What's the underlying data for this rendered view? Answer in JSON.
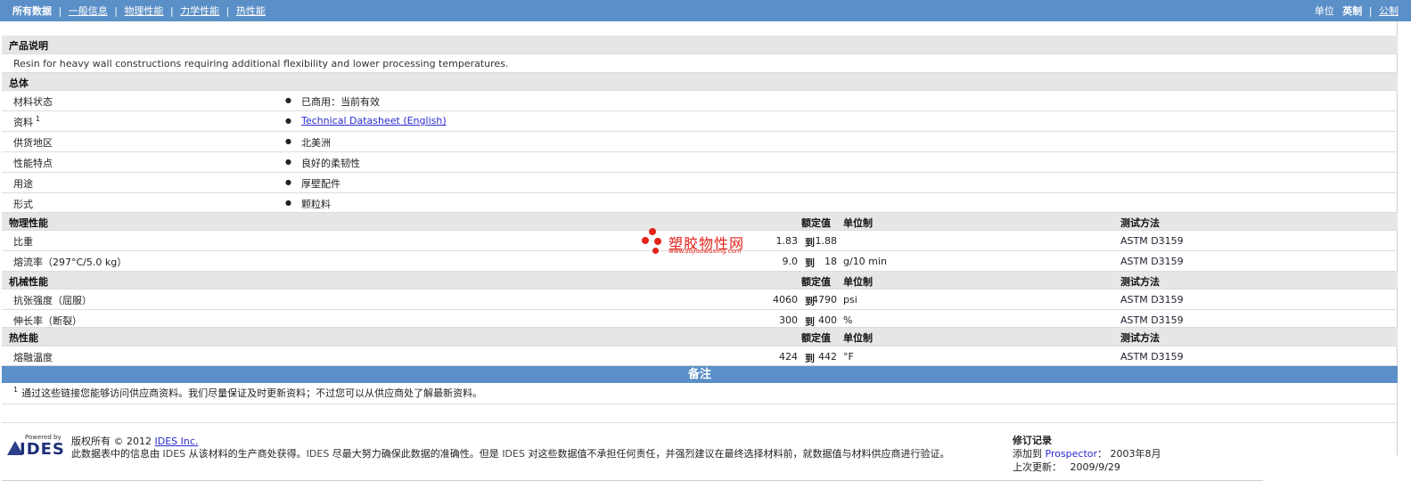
{
  "nav": {
    "all_data": "所有数据",
    "tabs": [
      "一般信息",
      "物理性能",
      "力学性能",
      "热性能"
    ],
    "units_label": "单位",
    "unit_english": "英制",
    "unit_metric": "公制"
  },
  "product_desc": {
    "title": "产品说明",
    "text": "Resin for heavy wall constructions requiring additional flexibility and lower processing temperatures."
  },
  "general": {
    "title": "总体",
    "rows": [
      {
        "label": "材料状态",
        "value": "已商用：当前有效"
      },
      {
        "label": "资料",
        "sup": "1",
        "value": "Technical Datasheet (English)"
      },
      {
        "label": "供货地区",
        "value": "北美洲"
      },
      {
        "label": "性能特点",
        "value": "良好的柔韧性"
      },
      {
        "label": "用途",
        "value": "厚壁配件"
      },
      {
        "label": "形式",
        "value": "颗粒料"
      }
    ]
  },
  "headers": {
    "rated": "额定值",
    "unit": "单位制",
    "method": "测试方法",
    "to": "到"
  },
  "physical": {
    "title": "物理性能",
    "rows": [
      {
        "label": "比重",
        "min": "1.83",
        "max": "1.88",
        "unit": "",
        "method": "ASTM D3159"
      },
      {
        "label": "熔流率（297°C/5.0 kg）",
        "min": "9.0",
        "max": "18",
        "unit": "g/10 min",
        "method": "ASTM D3159"
      }
    ]
  },
  "mechanical": {
    "title": "机械性能",
    "rows": [
      {
        "label": "抗张强度（屈服）",
        "min": "4060",
        "max": "4790",
        "unit": "psi",
        "method": "ASTM D3159"
      },
      {
        "label": "伸长率（断裂）",
        "min": "300",
        "max": "400",
        "unit": "%",
        "method": "ASTM D3159"
      }
    ]
  },
  "thermal": {
    "title": "热性能",
    "rows": [
      {
        "label": "熔融温度",
        "min": "424",
        "max": "442",
        "unit": "°F",
        "method": "ASTM D3159"
      }
    ]
  },
  "notes": {
    "title": "备注",
    "sup": "1",
    "text": "通过这些链接您能够访问供应商资料。我们尽量保证及时更新资料；不过您可以从供应商处了解最新资料。"
  },
  "watermark": {
    "title": "塑胶物性网",
    "url": "www.sujiaowuxing.com"
  },
  "footer": {
    "logo_powered": "Powered by",
    "logo_word": "IDES",
    "copyright": "版权所有 © 2012 ",
    "copyright_link": "IDES Inc.",
    "disclaimer_pre": "此数据表中的信息由 ",
    "disclaimer_ides1": "IDES",
    "disclaimer_mid": " 从该材料的生产商处获得。",
    "disclaimer_ides2": "IDES",
    "disclaimer_mid2": " 尽最大努力确保此数据的准确性。但是 ",
    "disclaimer_ides3": "IDES",
    "disclaimer_end": " 对这些数据值不承担任何责任，并强烈建议在最终选择材料前，就数据值与材料供应商进行验证。",
    "rev_title": "修订记录",
    "added_label": "添加到 ",
    "added_target": "Prospector",
    "added_date": "：  2003年8月",
    "updated_label": "上次更新：",
    "updated_date": "2009/9/29"
  },
  "colors": {
    "bar": "#5b8fc7",
    "section_bg": "#e6e6e6",
    "watermark": "#e2231a",
    "link": "#2a2ad0"
  }
}
